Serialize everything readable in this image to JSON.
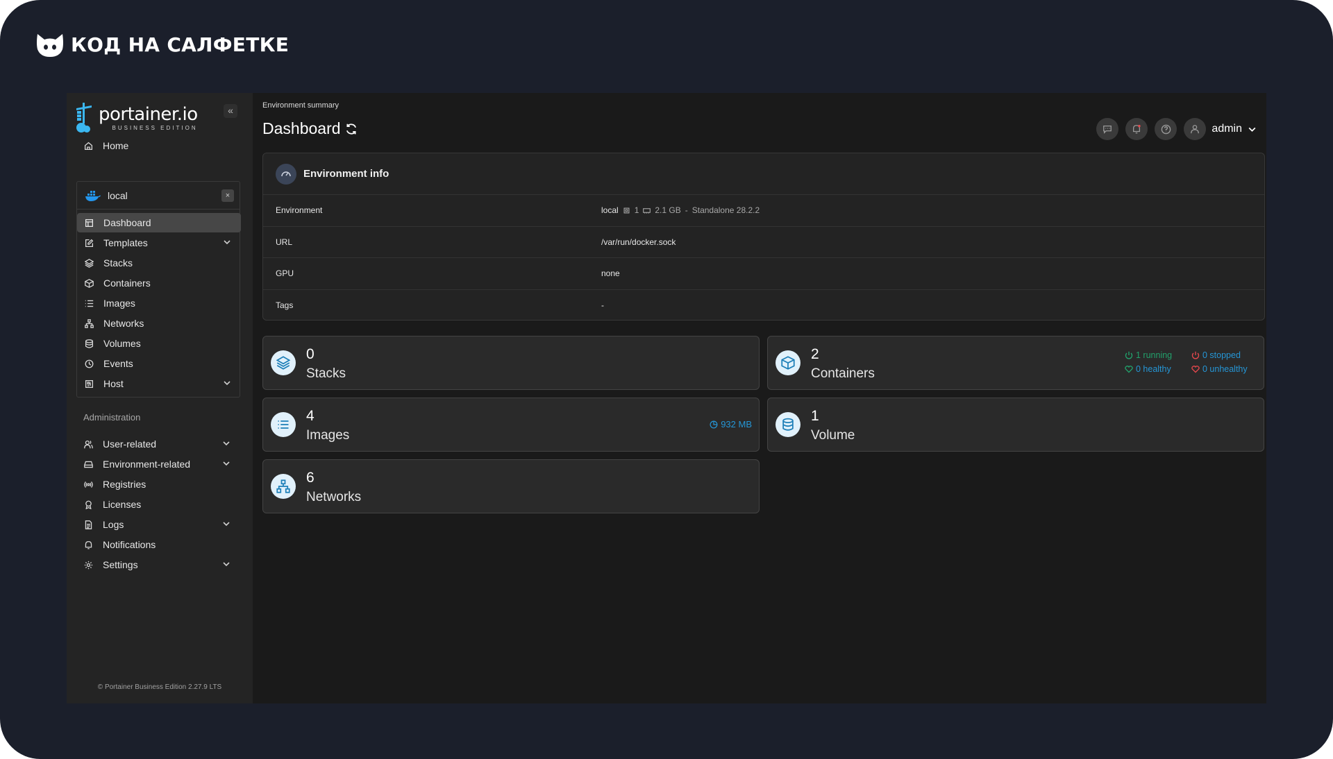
{
  "brand": {
    "name": "КОД НА САЛФЕТКЕ"
  },
  "sidebar": {
    "logo_name": "portainer.io",
    "logo_sub": "BUSINESS EDITION",
    "collapse_glyph": "«",
    "home_label": "Home",
    "environment": {
      "name": "local",
      "close_glyph": "×",
      "items": [
        {
          "label": "Dashboard",
          "icon": "dashboard-icon",
          "active": true
        },
        {
          "label": "Templates",
          "icon": "edit-icon",
          "expandable": true
        },
        {
          "label": "Stacks",
          "icon": "layers-icon"
        },
        {
          "label": "Containers",
          "icon": "box-icon"
        },
        {
          "label": "Images",
          "icon": "list-icon"
        },
        {
          "label": "Networks",
          "icon": "network-icon"
        },
        {
          "label": "Volumes",
          "icon": "database-icon"
        },
        {
          "label": "Events",
          "icon": "clock-icon"
        },
        {
          "label": "Host",
          "icon": "host-icon",
          "expandable": true
        }
      ]
    },
    "admin_label": "Administration",
    "admin_items": [
      {
        "label": "User-related",
        "icon": "users-icon",
        "expandable": true
      },
      {
        "label": "Environment-related",
        "icon": "server-icon",
        "expandable": true
      },
      {
        "label": "Registries",
        "icon": "radio-icon"
      },
      {
        "label": "Licenses",
        "icon": "award-icon"
      },
      {
        "label": "Logs",
        "icon": "file-icon",
        "expandable": true
      },
      {
        "label": "Notifications",
        "icon": "bell-icon"
      },
      {
        "label": "Settings",
        "icon": "gear-icon",
        "expandable": true
      }
    ],
    "footer": "© Portainer Business Edition 2.27.9 LTS"
  },
  "header": {
    "breadcrumb": "Environment summary",
    "title": "Dashboard",
    "user": "admin"
  },
  "env_info": {
    "title": "Environment info",
    "rows": [
      {
        "key": "Environment",
        "name": "local",
        "cpu": "1",
        "memory": "2.1 GB",
        "sep": "-",
        "type": "Standalone 28.2.2"
      },
      {
        "key": "URL",
        "value": "/var/run/docker.sock"
      },
      {
        "key": "GPU",
        "value": "none"
      },
      {
        "key": "Tags",
        "value": "-"
      }
    ]
  },
  "stats": {
    "stacks": {
      "count": "0",
      "label": "Stacks"
    },
    "containers": {
      "count": "2",
      "label": "Containers",
      "running": "1 running",
      "stopped": "0 stopped",
      "healthy": "0 healthy",
      "unhealthy": "0 unhealthy"
    },
    "images": {
      "count": "4",
      "label": "Images",
      "size": "932 MB"
    },
    "volumes": {
      "count": "1",
      "label": "Volume"
    },
    "networks": {
      "count": "6",
      "label": "Networks"
    }
  },
  "colors": {
    "accent": "#2596d6",
    "running": "#22a06b",
    "stopped": "#e5484d",
    "frame": "#1b1f2b"
  }
}
